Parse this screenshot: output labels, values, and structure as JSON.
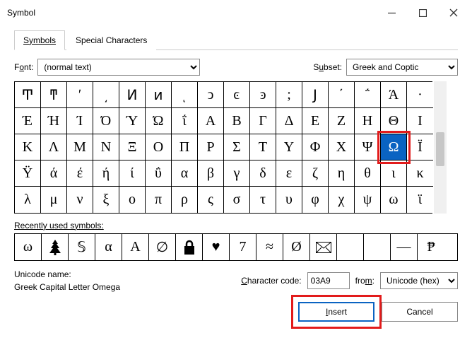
{
  "window": {
    "title": "Symbol"
  },
  "tabs": {
    "symbols": "Symbols",
    "special": "Special Characters"
  },
  "font": {
    "label_before": "F",
    "label_underlined": "o",
    "label_after": "nt:",
    "value": "(normal text)"
  },
  "subset": {
    "label_before": "S",
    "label_underlined": "u",
    "label_after": "bset:",
    "value": "Greek and Coptic"
  },
  "grid": {
    "rows": [
      [
        "Ͳ",
        "ͳ",
        "ʹ",
        "͵",
        "Ͷ",
        "ͷ",
        "ͺ",
        "ͻ",
        "ͼ",
        "ͽ",
        ";",
        "Ϳ",
        "΄",
        "΅",
        "Ά",
        "·"
      ],
      [
        "Έ",
        "Ή",
        "Ί",
        "Ό",
        "Ύ",
        "Ώ",
        "ΐ",
        "Α",
        "Β",
        "Γ",
        "Δ",
        "Ε",
        "Ζ",
        "Η",
        "Θ",
        "Ι"
      ],
      [
        "Κ",
        "Λ",
        "Μ",
        "Ν",
        "Ξ",
        "Ο",
        "Π",
        "Ρ",
        "Σ",
        "Τ",
        "Υ",
        "Φ",
        "Χ",
        "Ψ",
        "Ω",
        "Ϊ"
      ],
      [
        "Ϋ",
        "ά",
        "έ",
        "ή",
        "ί",
        "ΰ",
        "α",
        "β",
        "γ",
        "δ",
        "ε",
        "ζ",
        "η",
        "θ",
        "ι",
        "κ"
      ],
      [
        "λ",
        "μ",
        "ν",
        "ξ",
        "ο",
        "π",
        "ρ",
        "ς",
        "σ",
        "τ",
        "υ",
        "φ",
        "χ",
        "ψ",
        "ω",
        "ϊ"
      ]
    ],
    "selected": {
      "row": 2,
      "col": 14
    }
  },
  "recent": {
    "label": "Recently used symbols:",
    "items": [
      "ω",
      "🎄",
      "𝕊",
      "α",
      "Α",
      "∅",
      "🔒",
      "♥",
      "7",
      "≈",
      "Ø",
      "✉",
      "",
      "",
      "―",
      "₱"
    ]
  },
  "unicode": {
    "label": "Unicode name:",
    "name": "Greek Capital Letter Omega"
  },
  "charcode": {
    "label_underlined": "C",
    "label_after": "haracter code:",
    "value": "03A9"
  },
  "from": {
    "label_before": "fro",
    "label_underlined": "m",
    "label_after": ":",
    "value": "Unicode (hex)"
  },
  "buttons": {
    "insert_underlined": "I",
    "insert_after": "nsert",
    "cancel": "Cancel"
  }
}
